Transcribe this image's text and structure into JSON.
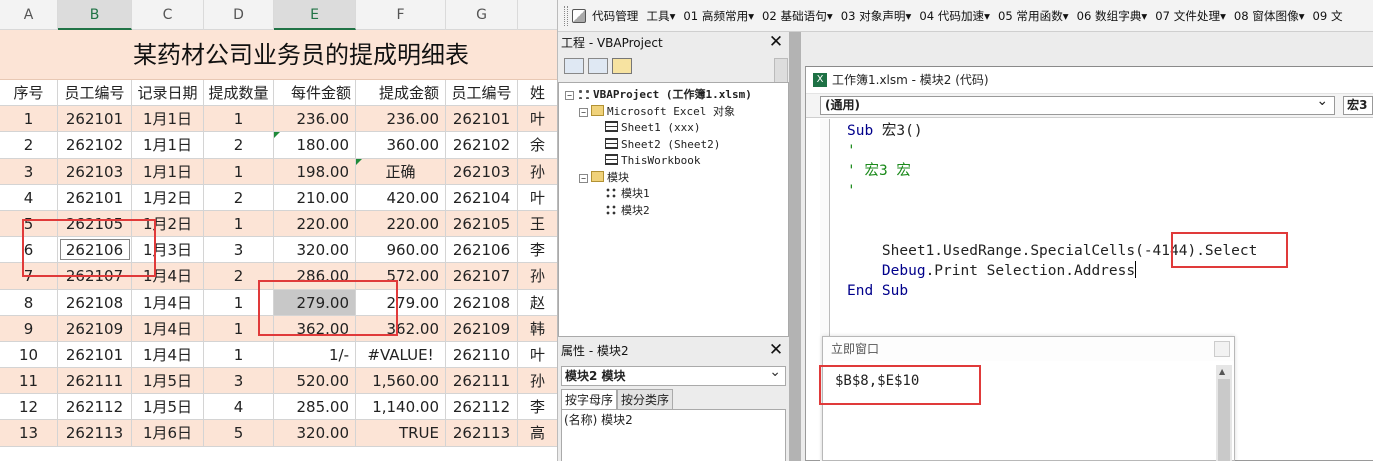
{
  "excel": {
    "col_headers": [
      "A",
      "B",
      "C",
      "D",
      "E",
      "F",
      "G",
      ""
    ],
    "title": "某药材公司业务员的提成明细表",
    "table_headers": [
      "序号",
      "员工编号",
      "记录日期",
      "提成数量",
      "每件金额",
      "提成金额",
      "员工编号",
      "姓"
    ],
    "rows": [
      [
        "1",
        "262101",
        "1月1日",
        "1",
        "236.00",
        "236.00",
        "262101",
        "叶"
      ],
      [
        "2",
        "262102",
        "1月1日",
        "2",
        "180.00",
        "360.00",
        "262102",
        "余"
      ],
      [
        "3",
        "262103",
        "1月1日",
        "1",
        "198.00",
        "正确",
        "262103",
        "孙"
      ],
      [
        "4",
        "262101",
        "1月2日",
        "2",
        "210.00",
        "420.00",
        "262104",
        "叶"
      ],
      [
        "5",
        "262105",
        "1月2日",
        "1",
        "220.00",
        "220.00",
        "262105",
        "王"
      ],
      [
        "6",
        "262106",
        "1月3日",
        "3",
        "320.00",
        "960.00",
        "262106",
        "李"
      ],
      [
        "7",
        "262107",
        "1月4日",
        "2",
        "286.00",
        "572.00",
        "262107",
        "孙"
      ],
      [
        "8",
        "262108",
        "1月4日",
        "1",
        "279.00",
        "279.00",
        "262108",
        "赵"
      ],
      [
        "9",
        "262109",
        "1月4日",
        "1",
        "362.00",
        "362.00",
        "262109",
        "韩"
      ],
      [
        "10",
        "262101",
        "1月4日",
        "1",
        "1/-",
        "#VALUE!",
        "262110",
        "叶"
      ],
      [
        "11",
        "262111",
        "1月5日",
        "3",
        "520.00",
        "1,560.00",
        "262111",
        "孙"
      ],
      [
        "12",
        "262112",
        "1月5日",
        "4",
        "285.00",
        "1,140.00",
        "262112",
        "李"
      ],
      [
        "13",
        "262113",
        "1月6日",
        "5",
        "320.00",
        "TRUE",
        "262113",
        "高"
      ]
    ]
  },
  "vbe": {
    "toolbar": [
      "代码管理",
      "工具▾",
      "01 高频常用▾",
      "02 基础语句▾",
      "03 对象声明▾",
      "04 代码加速▾",
      "05 常用函数▾",
      "06 数组字典▾",
      "07 文件处理▾",
      "08 窗体图像▾",
      "09 文"
    ],
    "project_title": "工程 - VBAProject",
    "close_glyph": "✕",
    "tree": {
      "root": "VBAProject (工作簿1.xlsm)",
      "excel_objects": "Microsoft Excel 对象",
      "sheet1": "Sheet1 (xxx)",
      "sheet2": "Sheet2 (Sheet2)",
      "thisworkbook": "ThisWorkbook",
      "modules": "模块",
      "module1": "模块1",
      "module2": "模块2"
    },
    "props_title": "属性 - 模块2",
    "props_select": "模块2 模块",
    "props_tabs": [
      "按字母序",
      "按分类序"
    ],
    "props_row": "(名称) 模块2",
    "code_title": "工作簿1.xlsm - 模块2 (代码)",
    "combo_general": "(通用)",
    "combo_proc": "宏3",
    "code": {
      "l1_kw": "Sub",
      "l1_rest": " 宏3()",
      "l2": "'",
      "l3": "' 宏3 宏",
      "l4": "'",
      "l5_obj": "Sheet1.UsedRange.SpecialCells",
      "l5_arg": "(-4144).Select",
      "l6_kw": "Debug",
      "l6_rest": ".Print Selection.Address",
      "l7": "End Sub"
    },
    "immediate_title": "立即窗口",
    "immediate_text": "$B$8,$E$10"
  },
  "colors": {
    "peach": "#fce4d6",
    "highlight_red": "#e03a3a",
    "keyword_blue": "#00008b",
    "comment_green": "#1b8a1b"
  }
}
